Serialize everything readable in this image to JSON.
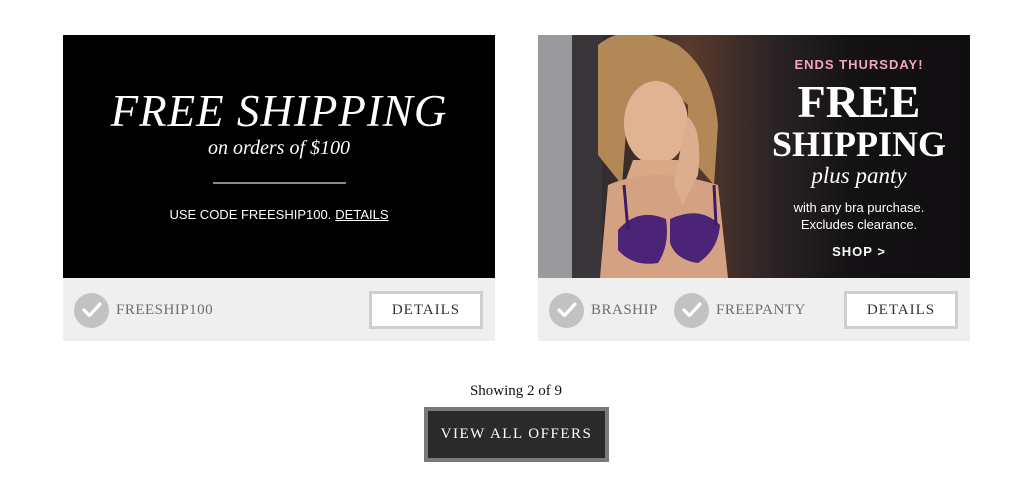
{
  "offers": [
    {
      "banner": {
        "title": "FREE SHIPPING",
        "subtitle": "on orders of $100",
        "code_text": "USE CODE FREESHIP100.",
        "details_link": "DETAILS"
      },
      "codes": [
        "FREESHIP100"
      ],
      "details_button": "DETAILS"
    },
    {
      "banner": {
        "ends": "ENDS THURSDAY!",
        "title_line1": "FREE",
        "title_line2": "SHIPPING",
        "subtitle": "plus panty",
        "line1": "with any bra purchase.",
        "line2": "Excludes clearance.",
        "shop": "SHOP >"
      },
      "codes": [
        "BRASHIP",
        "FREEPANTY"
      ],
      "details_button": "DETAILS"
    }
  ],
  "pagination": {
    "showing": "Showing 2 of 9"
  },
  "view_all_button": "VIEW ALL OFFERS",
  "icons": {
    "code_applied": "checkmark-icon"
  },
  "colors": {
    "accent_pink": "#f2a5bf",
    "button_dark": "#2a2a2a",
    "footer_gray": "#efefef"
  }
}
